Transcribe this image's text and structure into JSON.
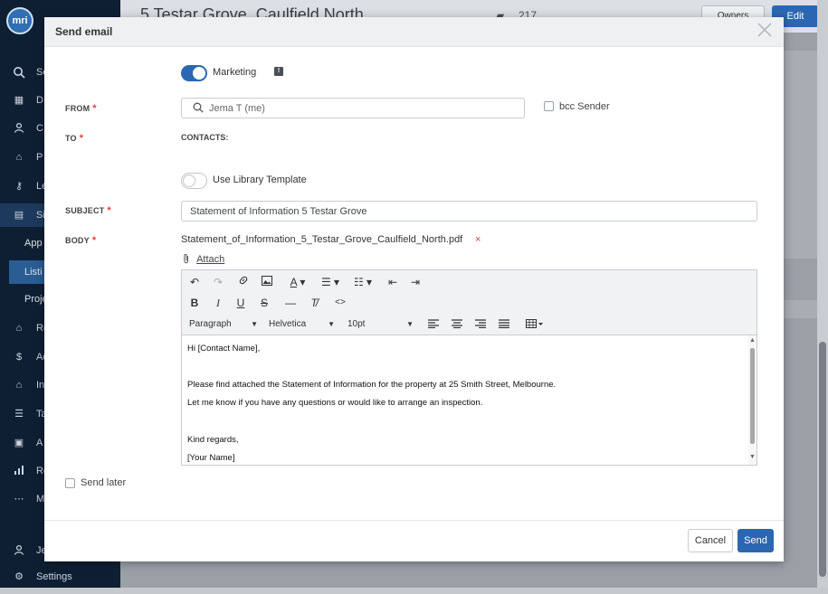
{
  "background": {
    "logo_text": "mri",
    "sidebar": {
      "items": [
        {
          "label": "Se",
          "icon": "search-icon"
        },
        {
          "label": "D",
          "icon": "grid-icon"
        },
        {
          "label": "C",
          "icon": "user-icon"
        },
        {
          "label": "P",
          "icon": "home-icon"
        },
        {
          "label": "Le",
          "icon": "key-icon"
        },
        {
          "label": "Si",
          "icon": "sign-icon"
        },
        {
          "label": "Re",
          "icon": "house-icon"
        },
        {
          "label": "Ac",
          "icon": "dollar-icon"
        },
        {
          "label": "In",
          "icon": "building-icon"
        },
        {
          "label": "Ta",
          "icon": "list-icon"
        },
        {
          "label": "A",
          "icon": "calendar-icon"
        },
        {
          "label": "Re",
          "icon": "bar-chart-icon"
        },
        {
          "label": "M",
          "icon": "more-icon"
        },
        {
          "label": "Je",
          "icon": "person-icon"
        },
        {
          "label": "Settings",
          "icon": "gear-icon"
        }
      ],
      "sub_items": [
        "App",
        "Listi",
        "Proje"
      ]
    },
    "header": {
      "title": "5 Testar Grove, Caulfield North",
      "count": "217",
      "owners_label": "Owners",
      "edit_label": "Edit"
    }
  },
  "modal": {
    "title": "Send email",
    "marketing_label": "Marketing",
    "marketing_on": true,
    "from_label": "FROM",
    "from_value": "Jema T (me)",
    "bcc_label": "bcc Sender",
    "to_label": "TO",
    "contacts_label": "CONTACTS:",
    "library_template_label": "Use Library Template",
    "subject_label": "SUBJECT",
    "subject_value": "Statement of Information 5 Testar Grove",
    "body_label": "BODY",
    "attachment_name": "Statement_of_Information_5_Testar_Grove_Caulfield_North.pdf",
    "attachment_remove": "×",
    "attach_label": "Attach",
    "required_mark": "*",
    "editor": {
      "block_format": "Paragraph",
      "font_family": "Helvetica",
      "font_size": "10pt",
      "body_lines": [
        "Hi [Contact Name],",
        "",
        "Please find attached the Statement of Information for the property at 25 Smith Street, Melbourne.",
        "Let me know if you have any questions or would like to arrange an inspection.",
        "",
        "Kind regards,",
        "[Your Name]"
      ]
    },
    "send_later_label": "Send later",
    "cancel_label": "Cancel",
    "send_label": "Send"
  },
  "colors": {
    "accent": "#2b67b0",
    "required": "#e0453a",
    "sidebar_bg": "#0f1f33"
  }
}
